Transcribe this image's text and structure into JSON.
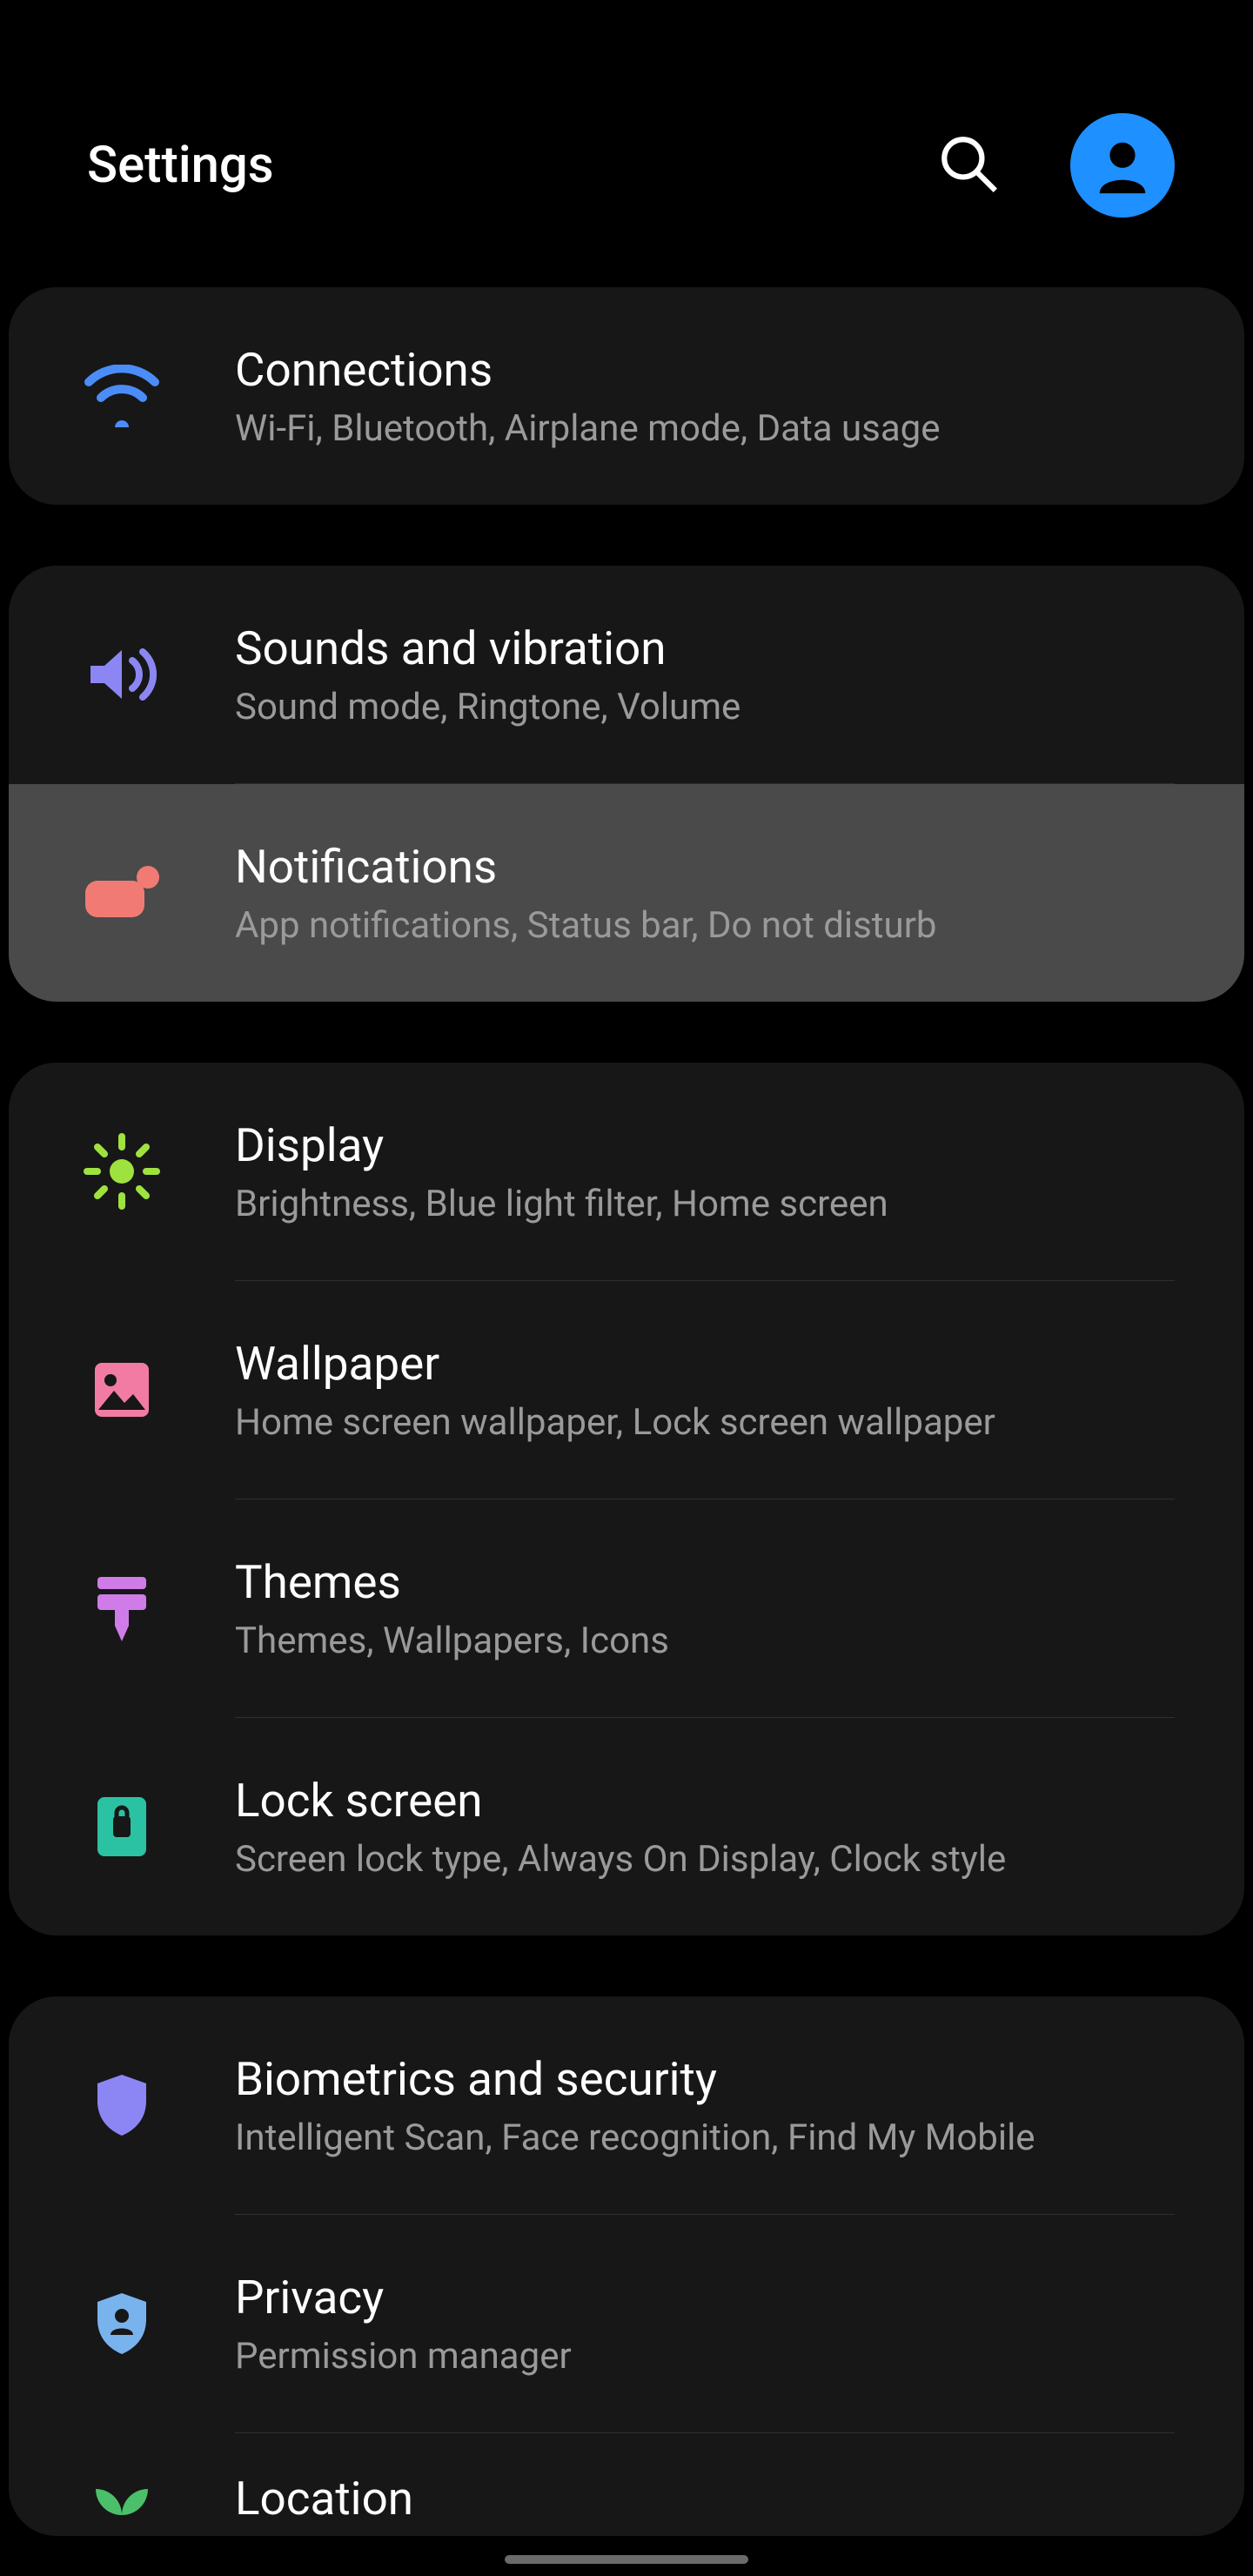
{
  "header": {
    "title": "Settings"
  },
  "colors": {
    "accent": "#1E90FF"
  },
  "groups": [
    {
      "items": [
        {
          "id": "connections",
          "title": "Connections",
          "sub": "Wi-Fi, Bluetooth, Airplane mode, Data usage",
          "icon": "wifi-icon",
          "icon_color": "#4B8DF8",
          "active": false
        }
      ]
    },
    {
      "items": [
        {
          "id": "sounds",
          "title": "Sounds and vibration",
          "sub": "Sound mode, Ringtone, Volume",
          "icon": "volume-icon",
          "icon_color": "#8C86F5",
          "active": false
        },
        {
          "id": "notifications",
          "title": "Notifications",
          "sub": "App notifications, Status bar, Do not disturb",
          "icon": "notification-icon",
          "icon_color": "#F17B74",
          "active": true
        }
      ]
    },
    {
      "items": [
        {
          "id": "display",
          "title": "Display",
          "sub": "Brightness, Blue light filter, Home screen",
          "icon": "brightness-icon",
          "icon_color": "#9FE23F",
          "active": false
        },
        {
          "id": "wallpaper",
          "title": "Wallpaper",
          "sub": "Home screen wallpaper, Lock screen wallpaper",
          "icon": "image-icon",
          "icon_color": "#F27BA4",
          "active": false
        },
        {
          "id": "themes",
          "title": "Themes",
          "sub": "Themes, Wallpapers, Icons",
          "icon": "paint-icon",
          "icon_color": "#D07CE8",
          "active": false
        },
        {
          "id": "lockscreen",
          "title": "Lock screen",
          "sub": "Screen lock type, Always On Display, Clock style",
          "icon": "lock-icon",
          "icon_color": "#2BC2A3",
          "active": false
        }
      ]
    },
    {
      "items": [
        {
          "id": "biometrics",
          "title": "Biometrics and security",
          "sub": "Intelligent Scan, Face recognition, Find My Mobile",
          "icon": "shield-icon",
          "icon_color": "#8C86F5",
          "active": false
        },
        {
          "id": "privacy",
          "title": "Privacy",
          "sub": "Permission manager",
          "icon": "shield-person-icon",
          "icon_color": "#79B3EE",
          "active": false
        },
        {
          "id": "location",
          "title": "Location",
          "sub": "",
          "icon": "location-icon",
          "icon_color": "#4BC06A",
          "active": false,
          "partial": true
        }
      ]
    }
  ]
}
